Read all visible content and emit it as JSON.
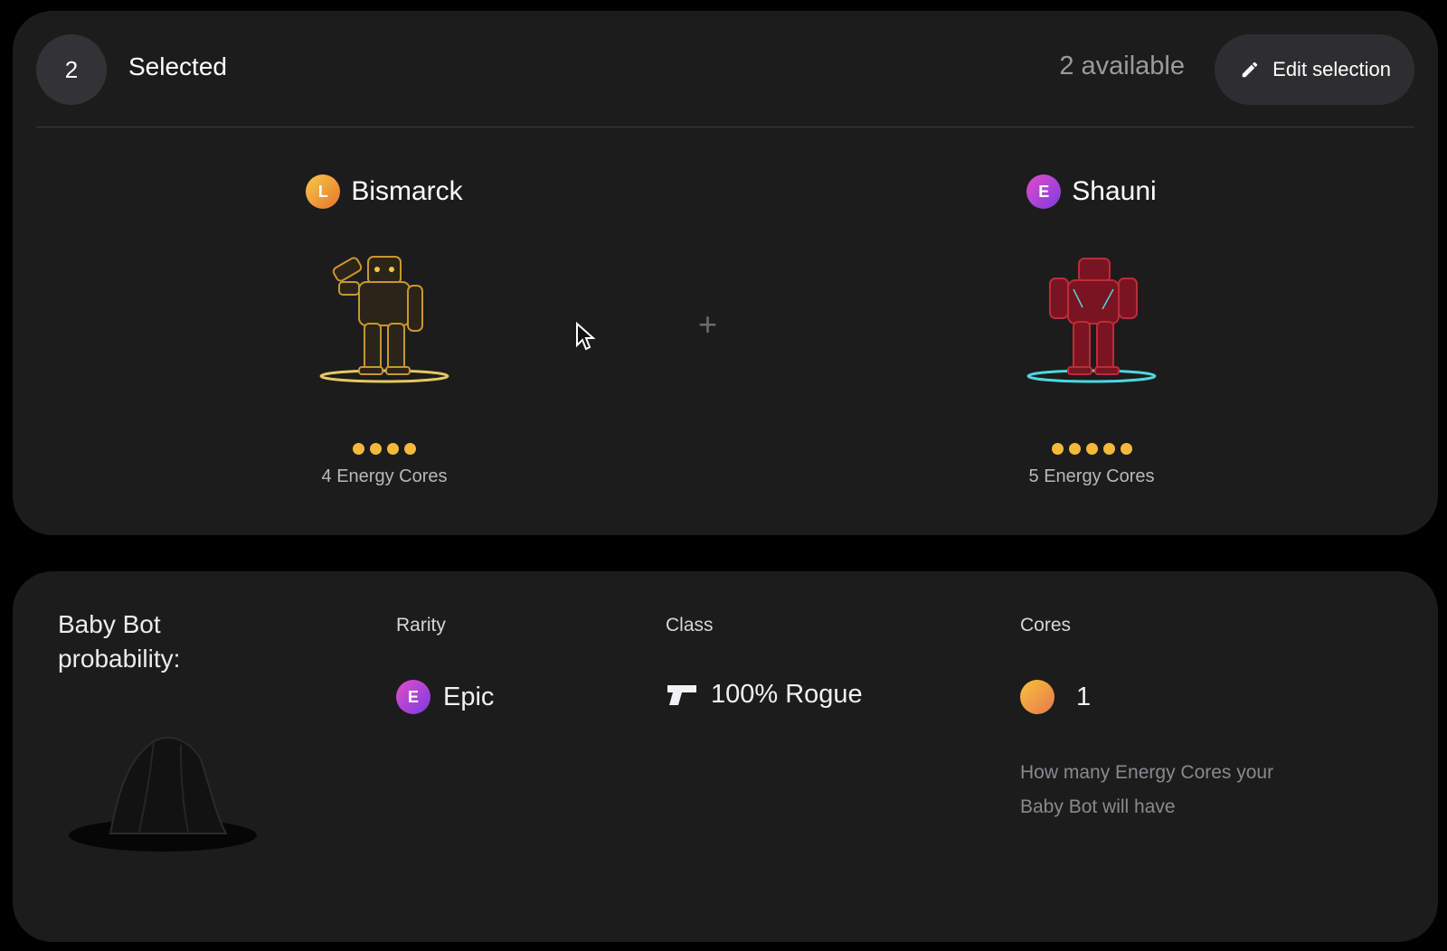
{
  "header": {
    "count": "2",
    "selected_label": "Selected",
    "available_text": "2 available",
    "edit_label": "Edit selection",
    "edit_icon": "pencil-icon"
  },
  "bots": [
    {
      "name": "Bismarck",
      "rarity_letter": "L",
      "rarity_color": "#f0a33a",
      "cores": 4,
      "cores_label": "4 Energy Cores",
      "figure_color": "#b8892a",
      "ring_color": "#e5c860"
    },
    {
      "name": "Shauni",
      "rarity_letter": "E",
      "rarity_color": "#b246d8",
      "cores": 5,
      "cores_label": "5 Energy Cores",
      "figure_color": "#a8202f",
      "ring_color": "#4fd6e0"
    }
  ],
  "combine_symbol": "+",
  "probability": {
    "title": "Baby Bot probability:",
    "rarity_label": "Rarity",
    "rarity_letter": "E",
    "rarity_value": "Epic",
    "class_label": "Class",
    "class_value": "100% Rogue",
    "class_icon": "pistol-icon",
    "cores_label": "Cores",
    "cores_value": "1",
    "cores_help": "How many Energy Cores your Baby Bot will have"
  },
  "colors": {
    "panel": "#1c1c1d",
    "core_dot": "#f3b93a",
    "epic": "#b246d8",
    "legendary": "#f0a33a"
  }
}
